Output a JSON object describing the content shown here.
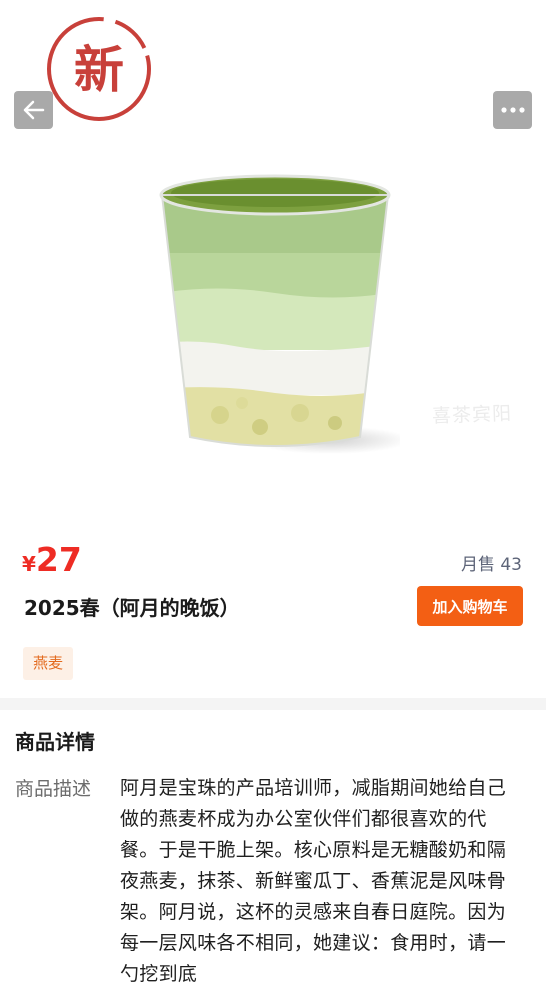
{
  "stamp": {
    "text": "新",
    "color": "#c8403a"
  },
  "nav": {
    "back_icon": "arrow-left-icon",
    "more_icon": "more-dots-icon"
  },
  "watermark": {
    "text": "喜茶宾阳"
  },
  "product": {
    "currency": "¥",
    "price": "27",
    "sales": "月售 43",
    "name": "2025春（阿月的晚饭）",
    "add_to_cart": "加入购物车",
    "tag": "燕麦"
  },
  "details": {
    "section_title": "商品详情",
    "desc_label": "商品描述",
    "desc_text": "阿月是宝珠的产品培训师，减脂期间她给自己做的燕麦杯成为办公室伙伴们都很喜欢的代餐。于是干脆上架。核心原料是无糖酸奶和隔夜燕麦，抹茶、新鲜蜜瓜丁、香蕉泥是风味骨架。阿月说，这杯的灵感来自春日庭院。因为每一层风味各不相同，她建议：食用时，请一勺挖到底"
  },
  "colors": {
    "accent": "#f35f14",
    "price": "#ee2c24",
    "tag_bg": "#fdf0e6",
    "tag_text": "#e36a1e"
  }
}
